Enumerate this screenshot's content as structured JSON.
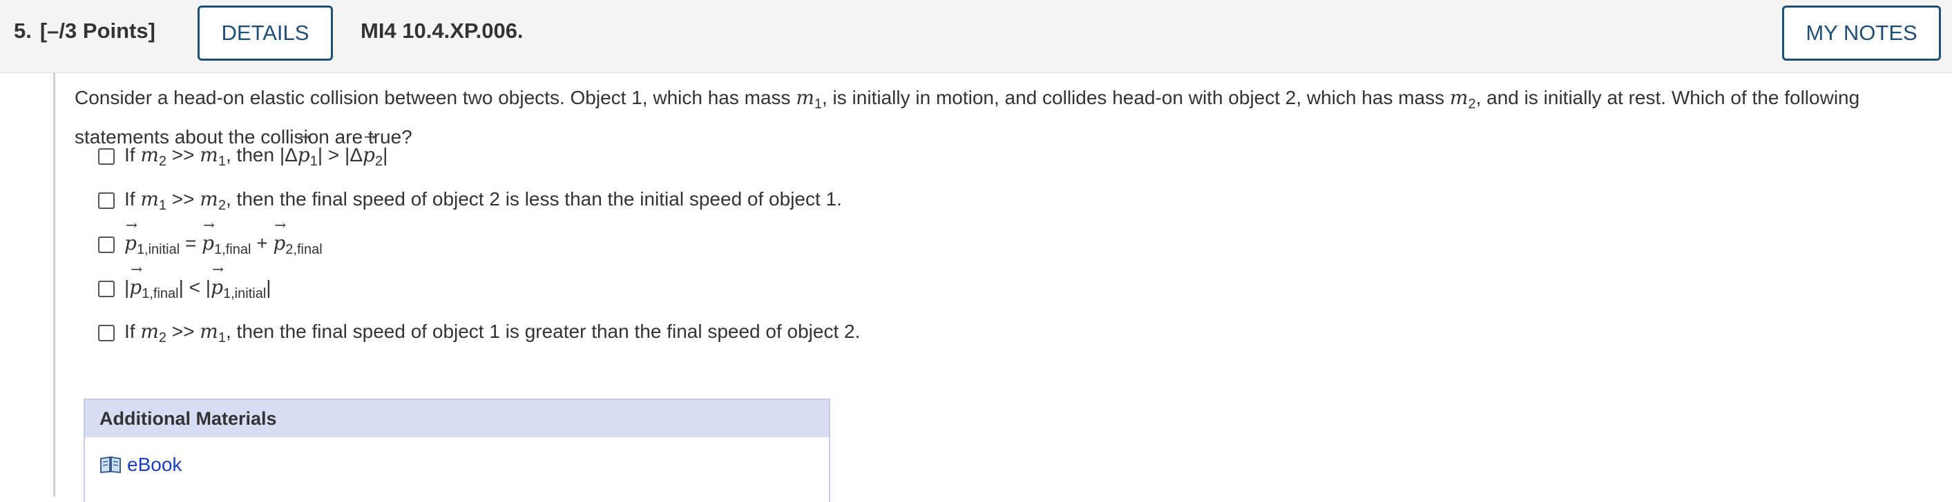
{
  "header": {
    "question_number": "5.",
    "points": "[–/3 Points]",
    "details_label": "DETAILS",
    "code": "MI4 10.4.XP.006.",
    "my_notes_label": "MY NOTES"
  },
  "question": {
    "p1": "Consider a head-on elastic collision between two objects. Object 1, which has mass ",
    "m": "m",
    "one": "1",
    "two": "2",
    "p2": ", is initially in motion, and collides head-on with object 2, which has mass ",
    "p3": ", and is initially at rest. Which of the following statements about the collision are true?"
  },
  "options": {
    "o1": {
      "if": "If ",
      "gg": " >> ",
      "then": ", then |Δ",
      "mid": "| > |Δ",
      "end": "|"
    },
    "o2": {
      "if": "If ",
      "gg": " >> ",
      "rest": ", then the final speed of object 2 is less than the initial speed of object 1."
    },
    "o3": {
      "p": "p",
      "s1": "1,initial",
      "eq": " = ",
      "s2": "1,final",
      "plus": " + ",
      "s3": "2,final"
    },
    "o4": {
      "bar": "|",
      "s1": "1,final",
      "lt": "| < |",
      "s2": "1,initial",
      "end": "|"
    },
    "o5": {
      "if": "If ",
      "gg": " >> ",
      "rest": ", then the final speed of object 1 is greater than the final speed of object 2."
    }
  },
  "materials": {
    "heading": "Additional Materials",
    "ebook_label": "eBook",
    "ebook_icon": "book-icon"
  },
  "colors": {
    "accent": "#1d4f7a",
    "link": "#1a3ec4",
    "materials_header": "#d9ddf3"
  }
}
